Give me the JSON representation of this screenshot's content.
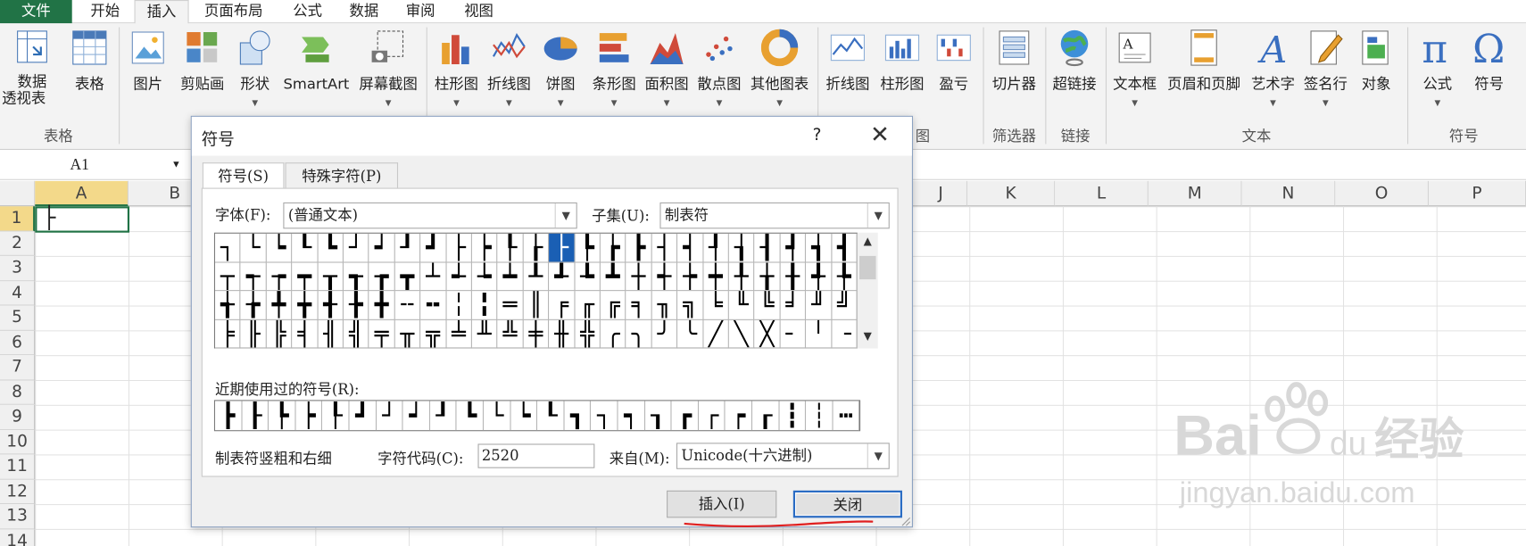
{
  "tabs": [
    "文件",
    "开始",
    "插入",
    "页面布局",
    "公式",
    "数据",
    "审阅",
    "视图"
  ],
  "ribbon": {
    "buttons": [
      "数据",
      "透视表",
      "表格",
      "图片",
      "剪贴画",
      "形状",
      "SmartArt",
      "屏幕截图",
      "柱形图",
      "折线图",
      "饼图",
      "条形图",
      "面积图",
      "散点图",
      "其他图表",
      "折线图",
      "柱形图",
      "盈亏",
      "切片器",
      "超链接",
      "文本框",
      "页眉和页脚",
      "艺术字",
      "签名行",
      "对象",
      "公式",
      "符号"
    ],
    "groups": [
      "表格",
      "图",
      "筛选器",
      "链接",
      "文本",
      "符号"
    ]
  },
  "namebox": "A1",
  "columns": [
    "A",
    "B",
    "J",
    "K",
    "L",
    "M",
    "N",
    "O",
    "P"
  ],
  "rows": [
    "1",
    "2",
    "3",
    "4",
    "5",
    "6",
    "7",
    "8",
    "9",
    "10",
    "11",
    "12",
    "13",
    "14"
  ],
  "cell_a1": "├",
  "dialog": {
    "title": "符号",
    "help": "?",
    "close": "✕",
    "tab_symbols": "符号(S)",
    "tab_special": "特殊字符(P)",
    "font_label": "字体(F):",
    "font_value": "(普通文本)",
    "subset_label": "子集(U):",
    "subset_value": "制表符",
    "symbol_rows": [
      [
        "┐",
        "└",
        "┕",
        "┖",
        "┗",
        "┘",
        "┙",
        "┚",
        "┛",
        "├",
        "┝",
        "┞",
        "┟",
        "├",
        "┡",
        "┢",
        "┣",
        "┤",
        "┥",
        "┦",
        "┧",
        "┨",
        "┩",
        "┪",
        "┫"
      ],
      [
        "┬",
        "┭",
        "┮",
        "┯",
        "┰",
        "┱",
        "┲",
        "┳",
        "┴",
        "┵",
        "┶",
        "┷",
        "┸",
        "┹",
        "┺",
        "┻",
        "┼",
        "┽",
        "┾",
        "┿",
        "╀",
        "╁",
        "╂",
        "╃",
        "╄"
      ],
      [
        "╅",
        "╆",
        "╇",
        "╈",
        "╉",
        "╊",
        "╋",
        "╌",
        "╍",
        "╎",
        "╏",
        "═",
        "║",
        "╒",
        "╓",
        "╔",
        "╕",
        "╖",
        "╗",
        "╘",
        "╙",
        "╚",
        "╛",
        "╜",
        "╝"
      ],
      [
        "╞",
        "╟",
        "╠",
        "╡",
        "╢",
        "╣",
        "╤",
        "╥",
        "╦",
        "╧",
        "╨",
        "╩",
        "╪",
        "╫",
        "╬",
        "╭",
        "╮",
        "╯",
        "╰",
        "╱",
        "╲",
        "╳",
        "╴",
        "╵",
        "╶"
      ]
    ],
    "recent_label": "近期使用过的符号(R):",
    "recent": [
      "┣",
      "┠",
      "┡",
      "┝",
      "┞",
      "┛",
      "┘",
      "┙",
      "┚",
      "┗",
      "└",
      "┕",
      "┖",
      "┓",
      "┐",
      "┑",
      "┒",
      "┏",
      "┌",
      "┍",
      "┎",
      "┇",
      "┆",
      "┅"
    ],
    "char_name": "制表符竖粗和右细",
    "code_label": "字符代码(C):",
    "code_value": "2520",
    "from_label": "来自(M):",
    "from_value": "Unicode(十六进制)",
    "insert_btn": "插入(I)",
    "close_btn": "关闭"
  },
  "watermark": {
    "brand": "Bai",
    "brand2": "du",
    "brand_cn": "经验",
    "url": "jingyan.baidu.com"
  }
}
